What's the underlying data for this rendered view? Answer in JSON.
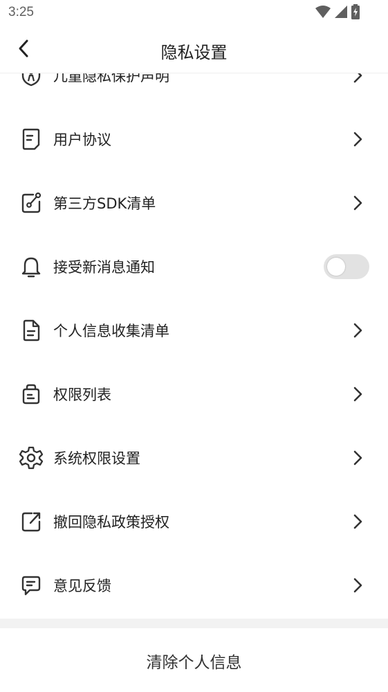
{
  "status_bar": {
    "time": "3:25",
    "icons": [
      "wifi-icon",
      "cellular-signal-icon",
      "battery-charging-icon"
    ]
  },
  "title_bar": {
    "title": "隐私设置",
    "back_icon": "chevron-left-icon"
  },
  "items": [
    {
      "label": "儿童隐私保护声明",
      "icon": "shield-child-icon",
      "trailing": "chevron"
    },
    {
      "label": "用户协议",
      "icon": "document-icon",
      "trailing": "chevron"
    },
    {
      "label": "第三方SDK清单",
      "icon": "edit-link-icon",
      "trailing": "chevron"
    },
    {
      "label": "接受新消息通知",
      "icon": "bell-icon",
      "trailing": "toggle",
      "toggle_on": false
    },
    {
      "label": "个人信息收集清单",
      "icon": "file-list-icon",
      "trailing": "chevron"
    },
    {
      "label": "权限列表",
      "icon": "bag-icon",
      "trailing": "chevron"
    },
    {
      "label": "系统权限设置",
      "icon": "gear-icon",
      "trailing": "chevron"
    },
    {
      "label": "撤回隐私政策授权",
      "icon": "revoke-share-icon",
      "trailing": "chevron"
    },
    {
      "label": "意见反馈",
      "icon": "feedback-icon",
      "trailing": "chevron"
    }
  ],
  "bottom_button": {
    "label": "清除个人信息"
  },
  "colors": {
    "text": "#222222",
    "icon": "#333333",
    "chevron": "#333333",
    "toggle_track_off": "#e2e2e2",
    "separator": "#f2f2f2"
  }
}
